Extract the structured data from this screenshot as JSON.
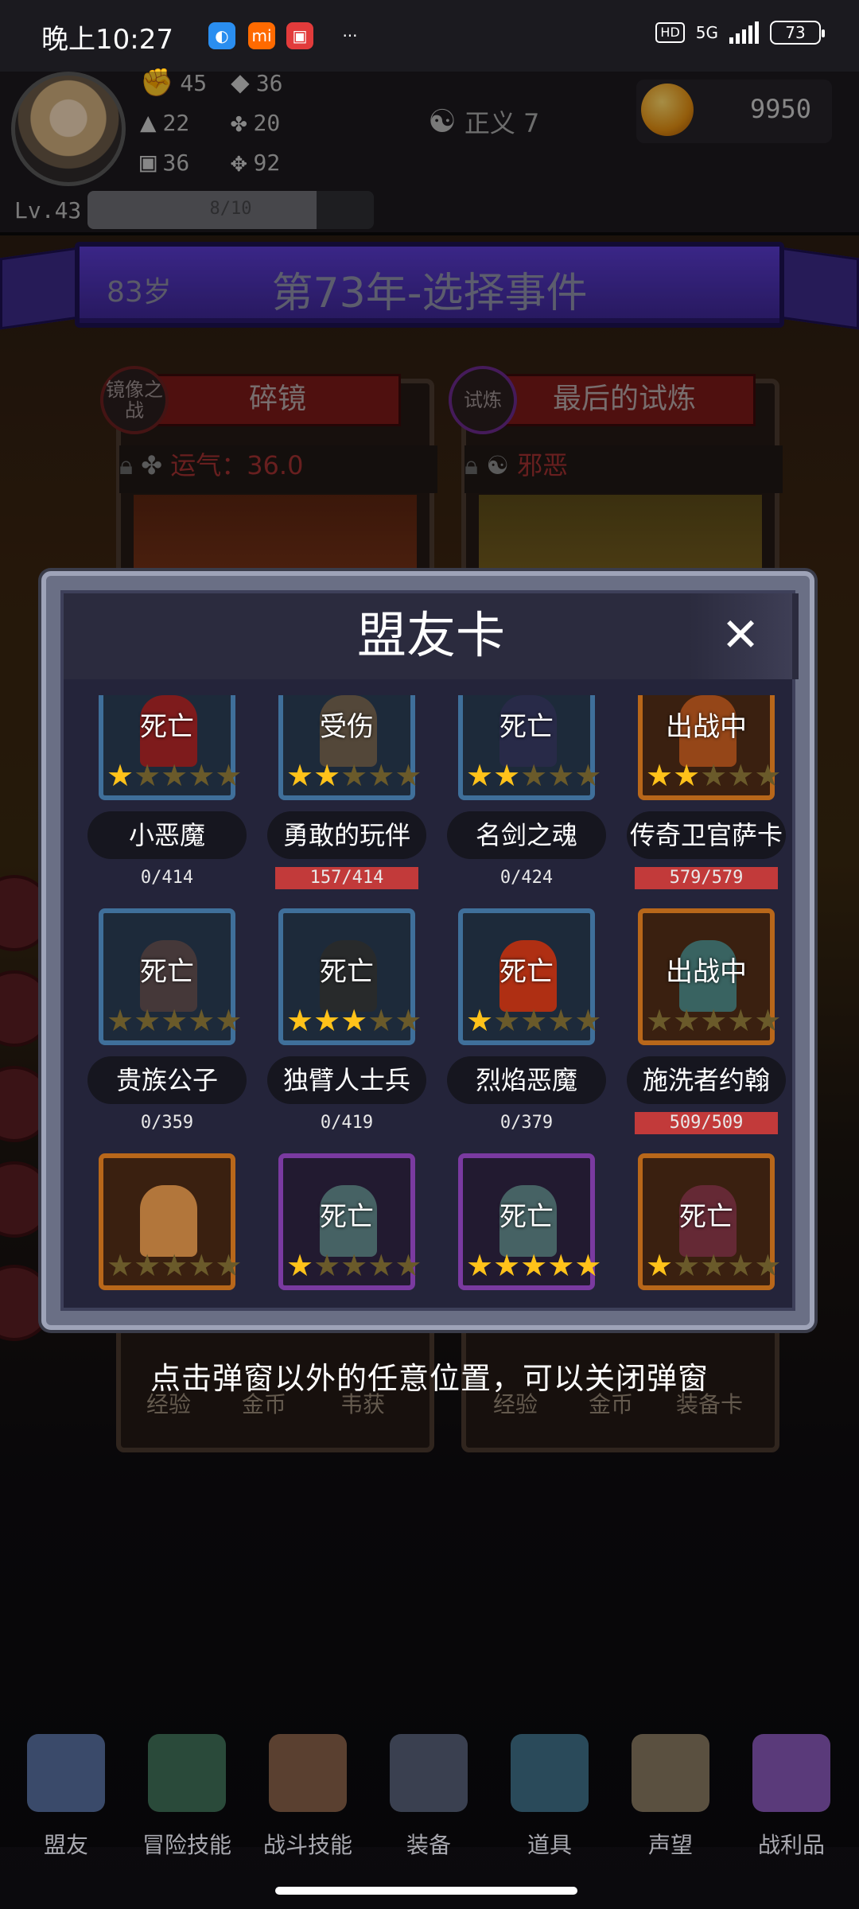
{
  "status_bar": {
    "time": "晚上10:27",
    "network": "5G",
    "hd": "HD",
    "battery": "73",
    "more": "···"
  },
  "player": {
    "stats": [
      {
        "icon": "fist-icon",
        "value": "45"
      },
      {
        "icon": "boot-icon",
        "value": "36"
      },
      {
        "icon": "wizard-hat-icon",
        "value": "22"
      },
      {
        "icon": "clover-icon",
        "value": "20"
      },
      {
        "icon": "armor-icon",
        "value": "36"
      },
      {
        "icon": "wings-icon",
        "value": "92"
      }
    ],
    "alignment": "正义 7",
    "coins": "9950",
    "level": "Lv.43",
    "exp": "8/10",
    "exp_fraction": 0.8
  },
  "event": {
    "age": "83岁",
    "title": "第73年-选择事件"
  },
  "cards": [
    {
      "badge": "镜像之战",
      "title": "碎镜",
      "effect": "运气：36.0",
      "rewards": [
        "经验",
        "金币",
        "韦获"
      ]
    },
    {
      "badge": "试炼",
      "title": "最后的试炼",
      "effect": "邪恶",
      "rewards": [
        "经验",
        "金币",
        "装备卡"
      ]
    }
  ],
  "modal": {
    "title": "盟友卡",
    "close": "✕",
    "allies": [
      {
        "name": "小恶魔",
        "state": "死亡",
        "stars": 1,
        "hp": "0/414",
        "hp_bar": false,
        "frame": "blue"
      },
      {
        "name": "勇敢的玩伴",
        "state": "受伤",
        "stars": 2,
        "hp": "157/414",
        "hp_bar": true,
        "frame": "blue"
      },
      {
        "name": "名剑之魂",
        "state": "死亡",
        "stars": 2,
        "hp": "0/424",
        "hp_bar": false,
        "frame": "blue"
      },
      {
        "name": "传奇卫官萨卡",
        "state": "出战中",
        "stars": 2,
        "hp": "579/579",
        "hp_bar": true,
        "frame": "gold"
      },
      {
        "name": "贵族公子",
        "state": "死亡",
        "stars": 0,
        "hp": "0/359",
        "hp_bar": false,
        "frame": "blue"
      },
      {
        "name": "独臂人士兵",
        "state": "死亡",
        "stars": 3,
        "hp": "0/419",
        "hp_bar": false,
        "frame": "blue"
      },
      {
        "name": "烈焰恶魔",
        "state": "死亡",
        "stars": 1,
        "hp": "0/379",
        "hp_bar": false,
        "frame": "blue"
      },
      {
        "name": "施洗者约翰",
        "state": "出战中",
        "stars": 0,
        "hp": "509/509",
        "hp_bar": true,
        "frame": "gold"
      },
      {
        "name": "",
        "state": "",
        "stars": 0,
        "hp": "",
        "hp_bar": false,
        "frame": "gold"
      },
      {
        "name": "",
        "state": "死亡",
        "stars": 1,
        "hp": "",
        "hp_bar": false,
        "frame": "purple"
      },
      {
        "name": "",
        "state": "死亡",
        "stars": 5,
        "hp": "",
        "hp_bar": false,
        "frame": "purple"
      },
      {
        "name": "",
        "state": "死亡",
        "stars": 1,
        "hp": "",
        "hp_bar": false,
        "frame": "gold"
      }
    ]
  },
  "hint": "点击弹窗以外的任意位置，可以关闭弹窗",
  "nav": [
    {
      "label": "盟友",
      "icon": "handshake-icon"
    },
    {
      "label": "冒险技能",
      "icon": "book-icon"
    },
    {
      "label": "战斗技能",
      "icon": "backpack-icon"
    },
    {
      "label": "装备",
      "icon": "swords-icon"
    },
    {
      "label": "道具",
      "icon": "amulet-icon"
    },
    {
      "label": "声望",
      "icon": "scroll-icon"
    },
    {
      "label": "战利品",
      "icon": "chest-icon"
    }
  ],
  "colors": {
    "accent_purple": "#4a2fb0",
    "hp_red": "#c23a3a",
    "star_gold": "#ffc21a"
  }
}
